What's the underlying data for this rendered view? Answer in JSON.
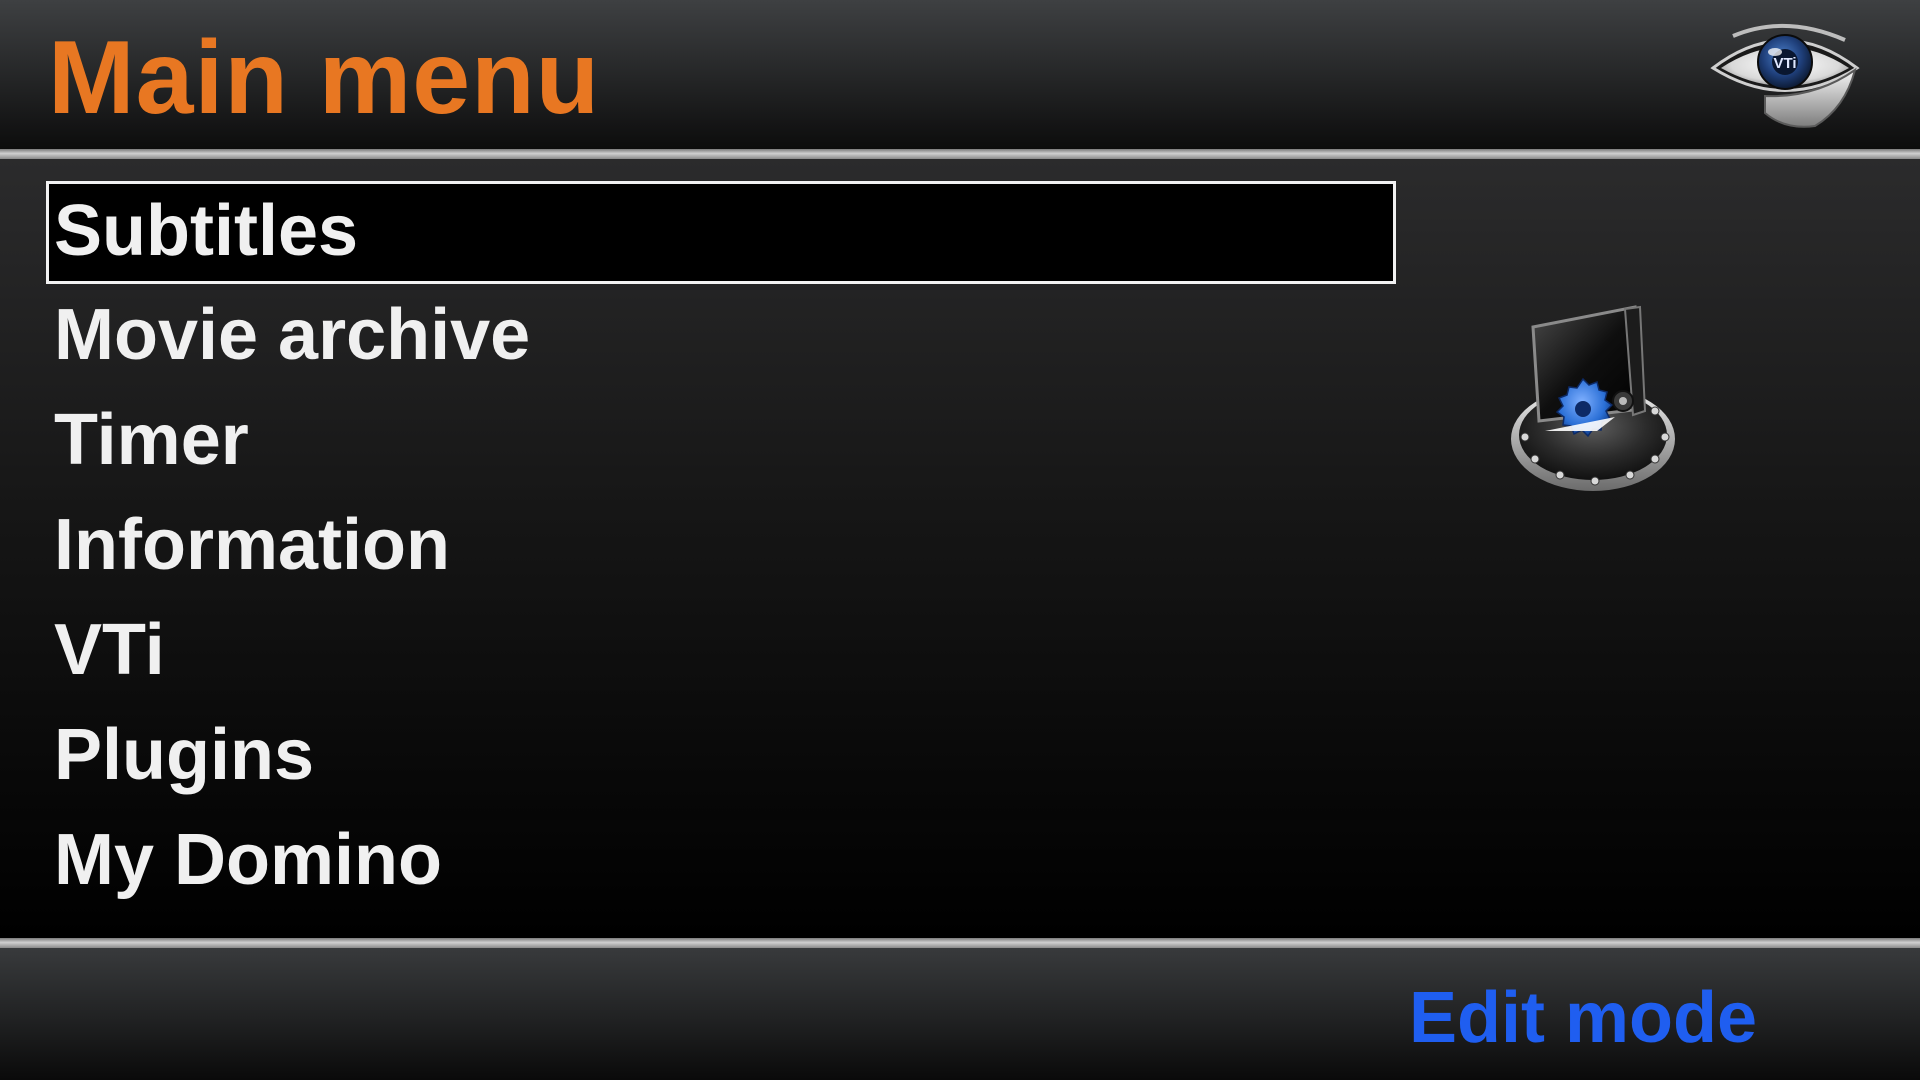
{
  "header": {
    "title": "Main menu",
    "logo_icon": "vti-eye-logo-icon",
    "logo_text": "VTi"
  },
  "menu": {
    "selected_index": 0,
    "items": [
      {
        "label": "Subtitles"
      },
      {
        "label": "Movie archive"
      },
      {
        "label": "Timer"
      },
      {
        "label": "Information"
      },
      {
        "label": "VTi"
      },
      {
        "label": "Plugins"
      },
      {
        "label": "My Domino"
      }
    ]
  },
  "preview": {
    "icon": "settings-gear-monitor-icon"
  },
  "footer": {
    "edit_mode_label": "Edit mode"
  },
  "colors": {
    "title": "#e87722",
    "menu_text": "#f0f0f0",
    "selection_border": "#f2f2f2",
    "edit_mode": "#1f5ef0",
    "gear_blue": "#2a6fd6"
  }
}
